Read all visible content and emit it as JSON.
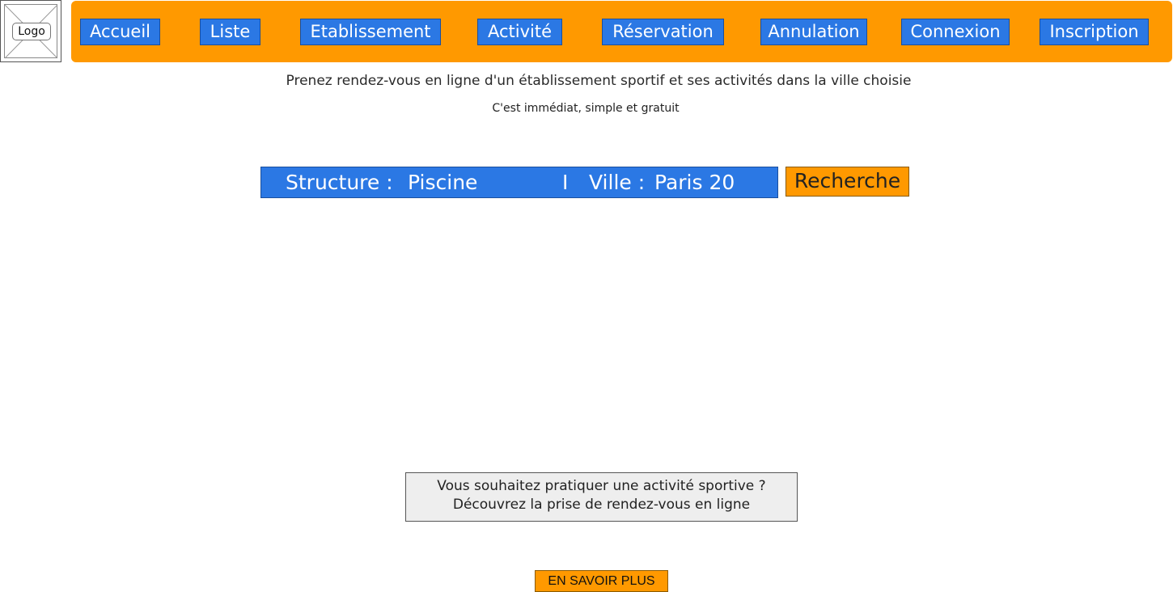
{
  "logo": {
    "label": "Logo"
  },
  "nav": {
    "items": [
      {
        "label": "Accueil"
      },
      {
        "label": "Liste"
      },
      {
        "label": "Etablissement"
      },
      {
        "label": "Activité"
      },
      {
        "label": "Réservation"
      },
      {
        "label": "Annulation"
      },
      {
        "label": "Connexion"
      },
      {
        "label": "Inscription"
      }
    ]
  },
  "hero": {
    "headline": "Prenez rendez-vous en ligne d'un établissement sportif et ses activités dans la ville choisie",
    "subline": "C'est immédiat, simple et gratuit"
  },
  "search": {
    "structure_label": "Structure :",
    "structure_value": "Piscine",
    "separator": "I",
    "city_label": "Ville :",
    "city_value": "Paris 20",
    "button_label": "Recherche"
  },
  "info": {
    "line1": "Vous souhaitez pratiquer une activité sportive ?",
    "line2": "Découvrez la prise de rendez-vous en ligne"
  },
  "cta": {
    "label": "EN SAVOIR PLUS"
  },
  "colors": {
    "accent_orange": "#ff9900",
    "accent_blue": "#2b78e4",
    "panel_grey": "#eeeeee"
  }
}
